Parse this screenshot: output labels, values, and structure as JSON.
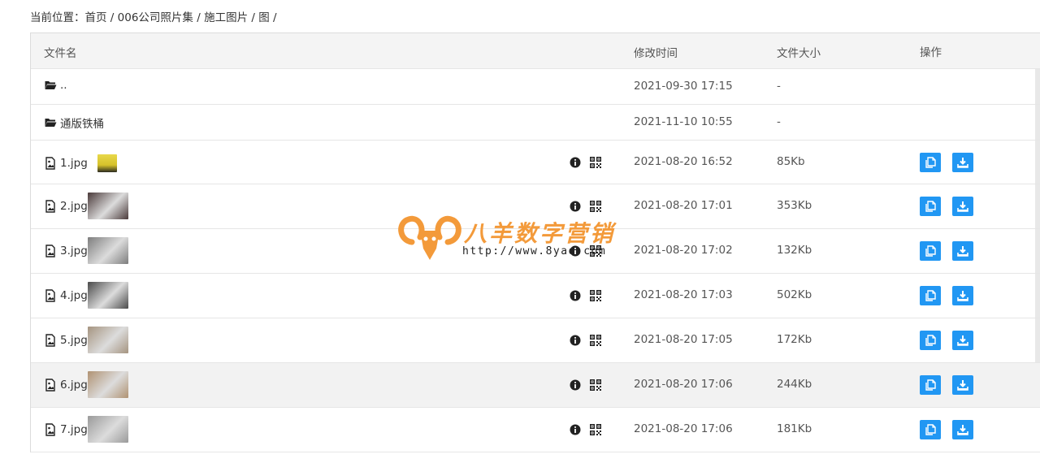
{
  "breadcrumb": {
    "prefix": "当前位置：",
    "items": [
      "首页",
      "006公司照片集",
      "施工图片",
      "图"
    ],
    "separator": "/"
  },
  "table": {
    "headers": {
      "name": "文件名",
      "modified": "修改时间",
      "size": "文件大小",
      "actions": "操作"
    },
    "rows": [
      {
        "name": "..",
        "kind": "folder",
        "modified": "2021-09-30 17:15",
        "size": "-"
      },
      {
        "name": "通版铁桶",
        "kind": "folder",
        "modified": "2021-11-10 10:55",
        "size": "-"
      },
      {
        "name": "1.jpg",
        "kind": "image",
        "modified": "2021-08-20 16:52",
        "size": "85Kb",
        "thumb_color": "#d8c43a"
      },
      {
        "name": "2.jpg",
        "kind": "image",
        "modified": "2021-08-20 17:01",
        "size": "353Kb",
        "thumb_color": "#4a3a3a"
      },
      {
        "name": "3.jpg",
        "kind": "image",
        "modified": "2021-08-20 17:02",
        "size": "132Kb",
        "thumb_color": "#7d7d7d"
      },
      {
        "name": "4.jpg",
        "kind": "image",
        "modified": "2021-08-20 17:03",
        "size": "502Kb",
        "thumb_color": "#4a4a4a"
      },
      {
        "name": "5.jpg",
        "kind": "image",
        "modified": "2021-08-20 17:05",
        "size": "172Kb",
        "thumb_color": "#a59480"
      },
      {
        "name": "6.jpg",
        "kind": "image",
        "modified": "2021-08-20 17:06",
        "size": "244Kb",
        "thumb_color": "#b09272",
        "highlighted": true
      },
      {
        "name": "7.jpg",
        "kind": "image",
        "modified": "2021-08-20 17:06",
        "size": "181Kb",
        "thumb_color": "#9a9a9a"
      }
    ]
  },
  "watermark": {
    "title": "八羊数字营销",
    "url": "http://www.8yad.com",
    "color": "#f39a3a"
  },
  "colors": {
    "accent": "#2197f3",
    "header_bg": "#f4f4f4",
    "highlight_bg": "#f2f2f2"
  },
  "icons": {
    "folder": "folder-open-icon",
    "image": "image-file-icon",
    "info": "info-circle-icon",
    "qr": "qrcode-icon",
    "copy": "copy-icon",
    "download": "download-icon"
  }
}
